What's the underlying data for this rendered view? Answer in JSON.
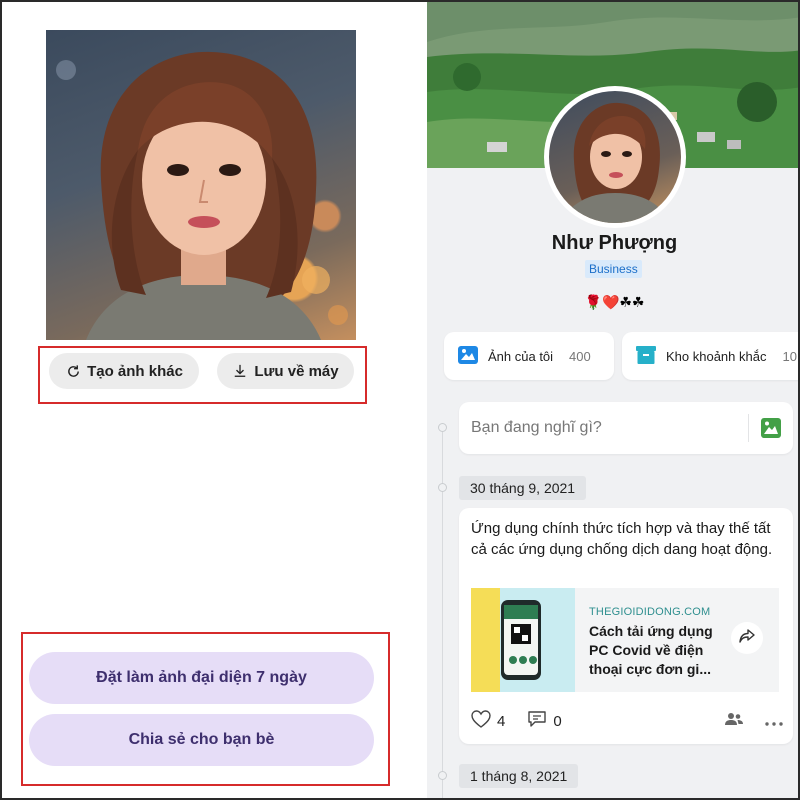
{
  "left_panel": {
    "regenerate_label": "Tạo ảnh khác",
    "save_label": "Lưu về máy",
    "set_avatar_label": "Đặt làm ảnh đại diện 7 ngày",
    "share_label": "Chia sẻ cho bạn bè"
  },
  "profile": {
    "name": "Như Phượng",
    "badge": "Business",
    "emoji_status": "🌹❤️☘☘"
  },
  "quick_links": [
    {
      "label": "Ảnh của tôi",
      "count": "400",
      "icon": "photo-icon"
    },
    {
      "label": "Kho khoảnh khắc",
      "count": "10",
      "icon": "archive-icon"
    }
  ],
  "compose": {
    "placeholder": "Bạn đang nghĩ gì?"
  },
  "timeline": {
    "date_1": "30 tháng 9, 2021",
    "post": {
      "text": "Ứng dụng chính thức tích hợp và thay thế tất cả các ứng dụng chống dịch dang hoạt động.",
      "link_domain": "THEGIOIDIDONG.COM",
      "link_title": "Cách tải ứng dụng PC Covid về điện thoại cực đơn gi...",
      "likes": "4",
      "comments": "0"
    },
    "date_2": "1 tháng 8, 2021"
  },
  "colors": {
    "highlight": "#d62b2b",
    "primary_button_bg": "#e6ddf7",
    "primary_button_text": "#3e2f6e",
    "badge_bg": "#d9eafb",
    "badge_text": "#1c6fc9"
  }
}
